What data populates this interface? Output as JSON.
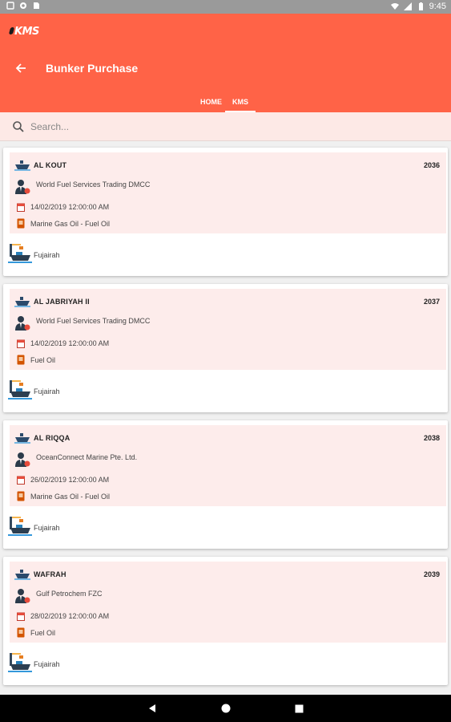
{
  "status_bar": {
    "time": "9:45"
  },
  "app": {
    "logo": "KMS",
    "title": "Bunker Purchase"
  },
  "tabs": [
    {
      "label": "HOME"
    },
    {
      "label": "KMS"
    }
  ],
  "search": {
    "placeholder": "Search..."
  },
  "records": [
    {
      "vessel": "AL KOUT",
      "number": "2036",
      "supplier": "World Fuel Services Trading DMCC",
      "date": "14/02/2019 12:00:00 AM",
      "fuel": "Marine Gas Oil - Fuel Oil",
      "port": "Fujairah"
    },
    {
      "vessel": "AL JABRIYAH  II",
      "number": "2037",
      "supplier": "World Fuel Services Trading DMCC",
      "date": "14/02/2019 12:00:00 AM",
      "fuel": "Fuel Oil",
      "port": "Fujairah"
    },
    {
      "vessel": "AL RIQQA",
      "number": "2038",
      "supplier": "OceanConnect Marine Pte. Ltd.",
      "date": "26/02/2019 12:00:00 AM",
      "fuel": "Marine Gas Oil - Fuel Oil",
      "port": "Fujairah"
    },
    {
      "vessel": "WAFRAH",
      "number": "2039",
      "supplier": "Gulf Petrochem FZC",
      "date": "28/02/2019 12:00:00 AM",
      "fuel": "Fuel Oil",
      "port": "Fujairah"
    }
  ],
  "colors": {
    "primary": "#ff6347",
    "card_inner": "#fdeceb",
    "search_bg": "#fde9e6"
  }
}
